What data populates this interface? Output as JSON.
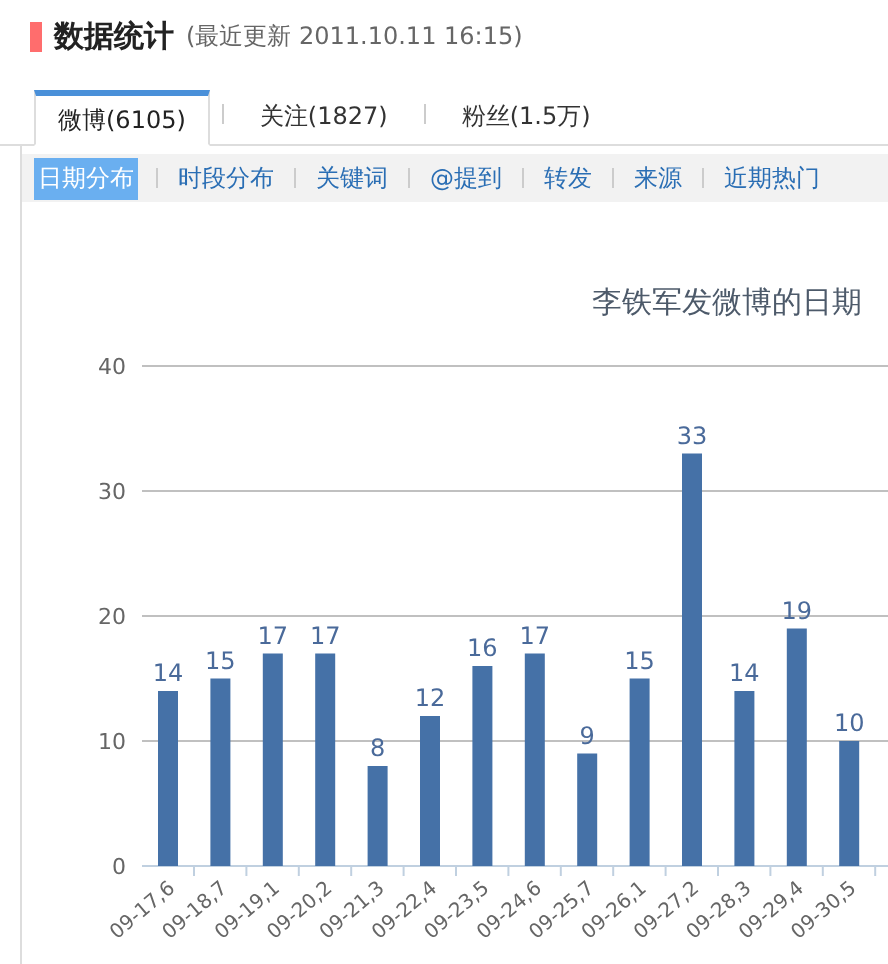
{
  "header": {
    "title": "数据统计",
    "updated": "(最近更新 2011.10.11 16:15)"
  },
  "tabs": [
    {
      "label": "微博(6105)",
      "selected": true
    },
    {
      "label": "关注(1827)",
      "selected": false
    },
    {
      "label": "粉丝(1.5万)",
      "selected": false
    }
  ],
  "subtabs": [
    {
      "label": "日期分布",
      "selected": true
    },
    {
      "label": "时段分布",
      "selected": false
    },
    {
      "label": "关键词",
      "selected": false
    },
    {
      "label": "@提到",
      "selected": false
    },
    {
      "label": "转发",
      "selected": false
    },
    {
      "label": "来源",
      "selected": false
    },
    {
      "label": "近期热门",
      "selected": false
    }
  ],
  "chart": {
    "chart_data": {
      "type": "bar",
      "title": "李铁军发微博的日期",
      "categories": [
        "09-17,6",
        "09-18,7",
        "09-19,1",
        "09-20,2",
        "09-21,3",
        "09-22,4",
        "09-23,5",
        "09-24,6",
        "09-25,7",
        "09-26,1",
        "09-27,2",
        "09-28,3",
        "09-29,4",
        "09-30,5"
      ],
      "series": [
        {
          "color": "#4571a7",
          "values": [
            14,
            15,
            17,
            17,
            8,
            12,
            16,
            17,
            9,
            15,
            33,
            14,
            19,
            10
          ]
        }
      ],
      "ylim": [
        0,
        40
      ],
      "yticks": [
        0,
        10,
        20,
        30,
        40
      ],
      "data_labels": true,
      "grid": true
    }
  }
}
